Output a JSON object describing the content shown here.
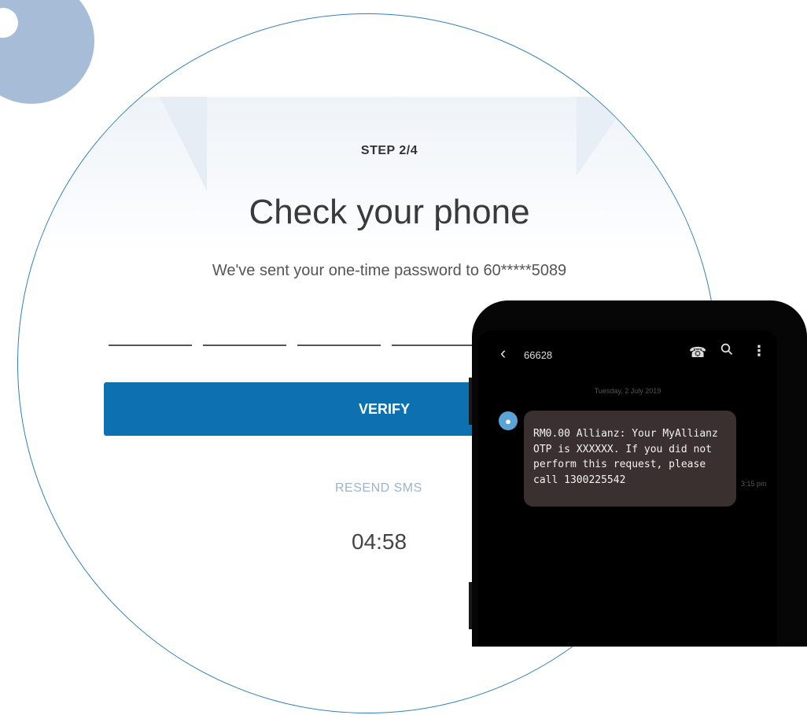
{
  "step": {
    "label": "STEP 2/4"
  },
  "header": {
    "title": "Check your phone",
    "subtitle": "We've sent your one-time password to 60*****5089"
  },
  "otp": {
    "fields": 4
  },
  "actions": {
    "verify_label": "VERIFY",
    "resend_label": "RESEND SMS",
    "timer": "04:58"
  },
  "phone": {
    "sender": "66628",
    "date": "Tuesday, 2 July 2019",
    "message": "RM0.00 Allianz: Your MyAllianz\nOTP is XXXXXX. If you did not\nperform this request, please\ncall 1300225542",
    "time": "3:15 pm",
    "icons": [
      "back-icon",
      "call-icon",
      "search-icon",
      "more-icon",
      "avatar-icon"
    ]
  },
  "colors": {
    "accent": "#0d70b1",
    "circle_border": "#2f7fc0",
    "resend": "#9bb5cf",
    "deco": "#a7bcd7",
    "bubble": "#3a3030"
  }
}
